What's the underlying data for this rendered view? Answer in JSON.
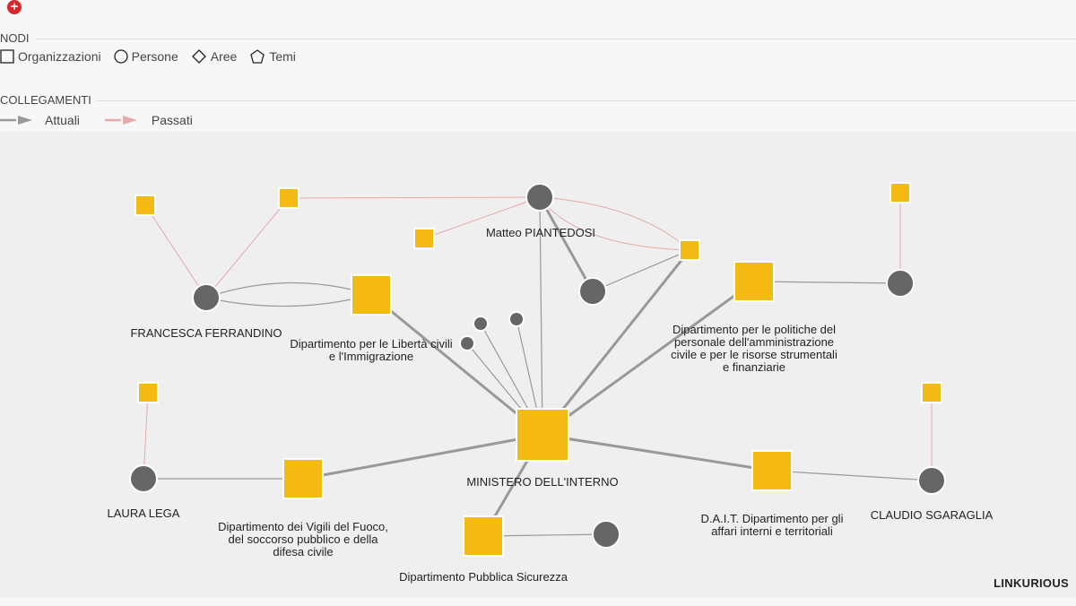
{
  "header": {
    "expand_icon": "plus-circle-icon",
    "expand_symbol": "+"
  },
  "legend": {
    "nodes_title": "NODI",
    "node_types": [
      {
        "shape": "square",
        "label": "Organizzazioni"
      },
      {
        "shape": "circle",
        "label": "Persone"
      },
      {
        "shape": "diamond",
        "label": "Aree"
      },
      {
        "shape": "pentagon",
        "label": "Temi"
      }
    ],
    "links_title": "COLLEGAMENTI",
    "link_types": [
      {
        "label": "Attuali",
        "color": "#999999"
      },
      {
        "label": "Passati",
        "color": "#e8a8a8"
      }
    ]
  },
  "colors": {
    "organization": "#f5b914",
    "person": "#666666",
    "current": "#999999",
    "past": "#e8a8a8",
    "background": "#efefef"
  },
  "graph": {
    "nodes": [
      {
        "id": "ministero",
        "type": "organization",
        "label": "MINISTERO DELL'INTERNO"
      },
      {
        "id": "piantedosi",
        "type": "person",
        "label": "Matteo PIANTEDOSI"
      },
      {
        "id": "ferrandino",
        "type": "person",
        "label": "FRANCESCA FERRANDINO"
      },
      {
        "id": "lega",
        "type": "person",
        "label": "LAURA LEGA"
      },
      {
        "id": "sgaraglia",
        "type": "person",
        "label": "CLAUDIO SGARAGLIA"
      },
      {
        "id": "dip_liberta",
        "type": "organization",
        "label": "Dipartimento per le Libertà civili e l'Immigrazione"
      },
      {
        "id": "dip_politiche",
        "type": "organization",
        "label": "Dipartimento per le politiche del personale dell'amministrazione civile e per le risorse strumentali e finanziarie"
      },
      {
        "id": "dip_vigili",
        "type": "organization",
        "label": "Dipartimento dei Vigili del Fuoco, del soccorso pubblico e della difesa civile"
      },
      {
        "id": "dait",
        "type": "organization",
        "label": "D.A.I.T. Dipartimento per gli affari interni e territoriali"
      },
      {
        "id": "dip_ps",
        "type": "organization",
        "label": "Dipartimento Pubblica Sicurezza"
      },
      {
        "id": "p_mid",
        "type": "person",
        "label": ""
      },
      {
        "id": "p_right",
        "type": "person",
        "label": ""
      },
      {
        "id": "p_ps",
        "type": "person",
        "label": ""
      },
      {
        "id": "p_s1",
        "type": "person",
        "label": ""
      },
      {
        "id": "p_s2",
        "type": "person",
        "label": ""
      },
      {
        "id": "p_s3",
        "type": "person",
        "label": ""
      },
      {
        "id": "o_tl",
        "type": "organization",
        "label": ""
      },
      {
        "id": "o_t2",
        "type": "organization",
        "label": ""
      },
      {
        "id": "o_t3",
        "type": "organization",
        "label": ""
      },
      {
        "id": "o_t4",
        "type": "organization",
        "label": ""
      },
      {
        "id": "o_tr",
        "type": "organization",
        "label": ""
      },
      {
        "id": "o_l2",
        "type": "organization",
        "label": ""
      },
      {
        "id": "o_r2",
        "type": "organization",
        "label": ""
      }
    ],
    "links": [
      {
        "from": "ministero",
        "to": "piantedosi",
        "type": "current"
      },
      {
        "from": "ministero",
        "to": "dip_liberta",
        "type": "current"
      },
      {
        "from": "ministero",
        "to": "dip_politiche",
        "type": "current"
      },
      {
        "from": "ministero",
        "to": "dip_vigili",
        "type": "current"
      },
      {
        "from": "ministero",
        "to": "dait",
        "type": "current"
      },
      {
        "from": "ministero",
        "to": "dip_ps",
        "type": "current"
      },
      {
        "from": "ministero",
        "to": "o_t4",
        "type": "current"
      },
      {
        "from": "ministero",
        "to": "p_s1",
        "type": "current"
      },
      {
        "from": "ministero",
        "to": "p_s2",
        "type": "current"
      },
      {
        "from": "ministero",
        "to": "p_s3",
        "type": "current"
      },
      {
        "from": "piantedosi",
        "to": "p_mid",
        "type": "current"
      },
      {
        "from": "piantedosi",
        "to": "o_t2",
        "type": "past"
      },
      {
        "from": "piantedosi",
        "to": "o_t3",
        "type": "past"
      },
      {
        "from": "piantedosi",
        "to": "o_t4",
        "type": "past"
      },
      {
        "from": "p_mid",
        "to": "o_t4",
        "type": "current"
      },
      {
        "from": "ferrandino",
        "to": "dip_liberta",
        "type": "current"
      },
      {
        "from": "ferrandino",
        "to": "dip_liberta",
        "type": "current"
      },
      {
        "from": "ferrandino",
        "to": "o_tl",
        "type": "past"
      },
      {
        "from": "ferrandino",
        "to": "o_t2",
        "type": "past"
      },
      {
        "from": "dip_politiche",
        "to": "p_right",
        "type": "current"
      },
      {
        "from": "p_right",
        "to": "o_tr",
        "type": "past"
      },
      {
        "from": "lega",
        "to": "dip_vigili",
        "type": "current"
      },
      {
        "from": "lega",
        "to": "o_l2",
        "type": "past"
      },
      {
        "from": "dait",
        "to": "sgaraglia",
        "type": "current"
      },
      {
        "from": "sgaraglia",
        "to": "o_r2",
        "type": "past"
      },
      {
        "from": "dip_ps",
        "to": "p_ps",
        "type": "current"
      }
    ]
  },
  "brand": "LINKURIOUS"
}
